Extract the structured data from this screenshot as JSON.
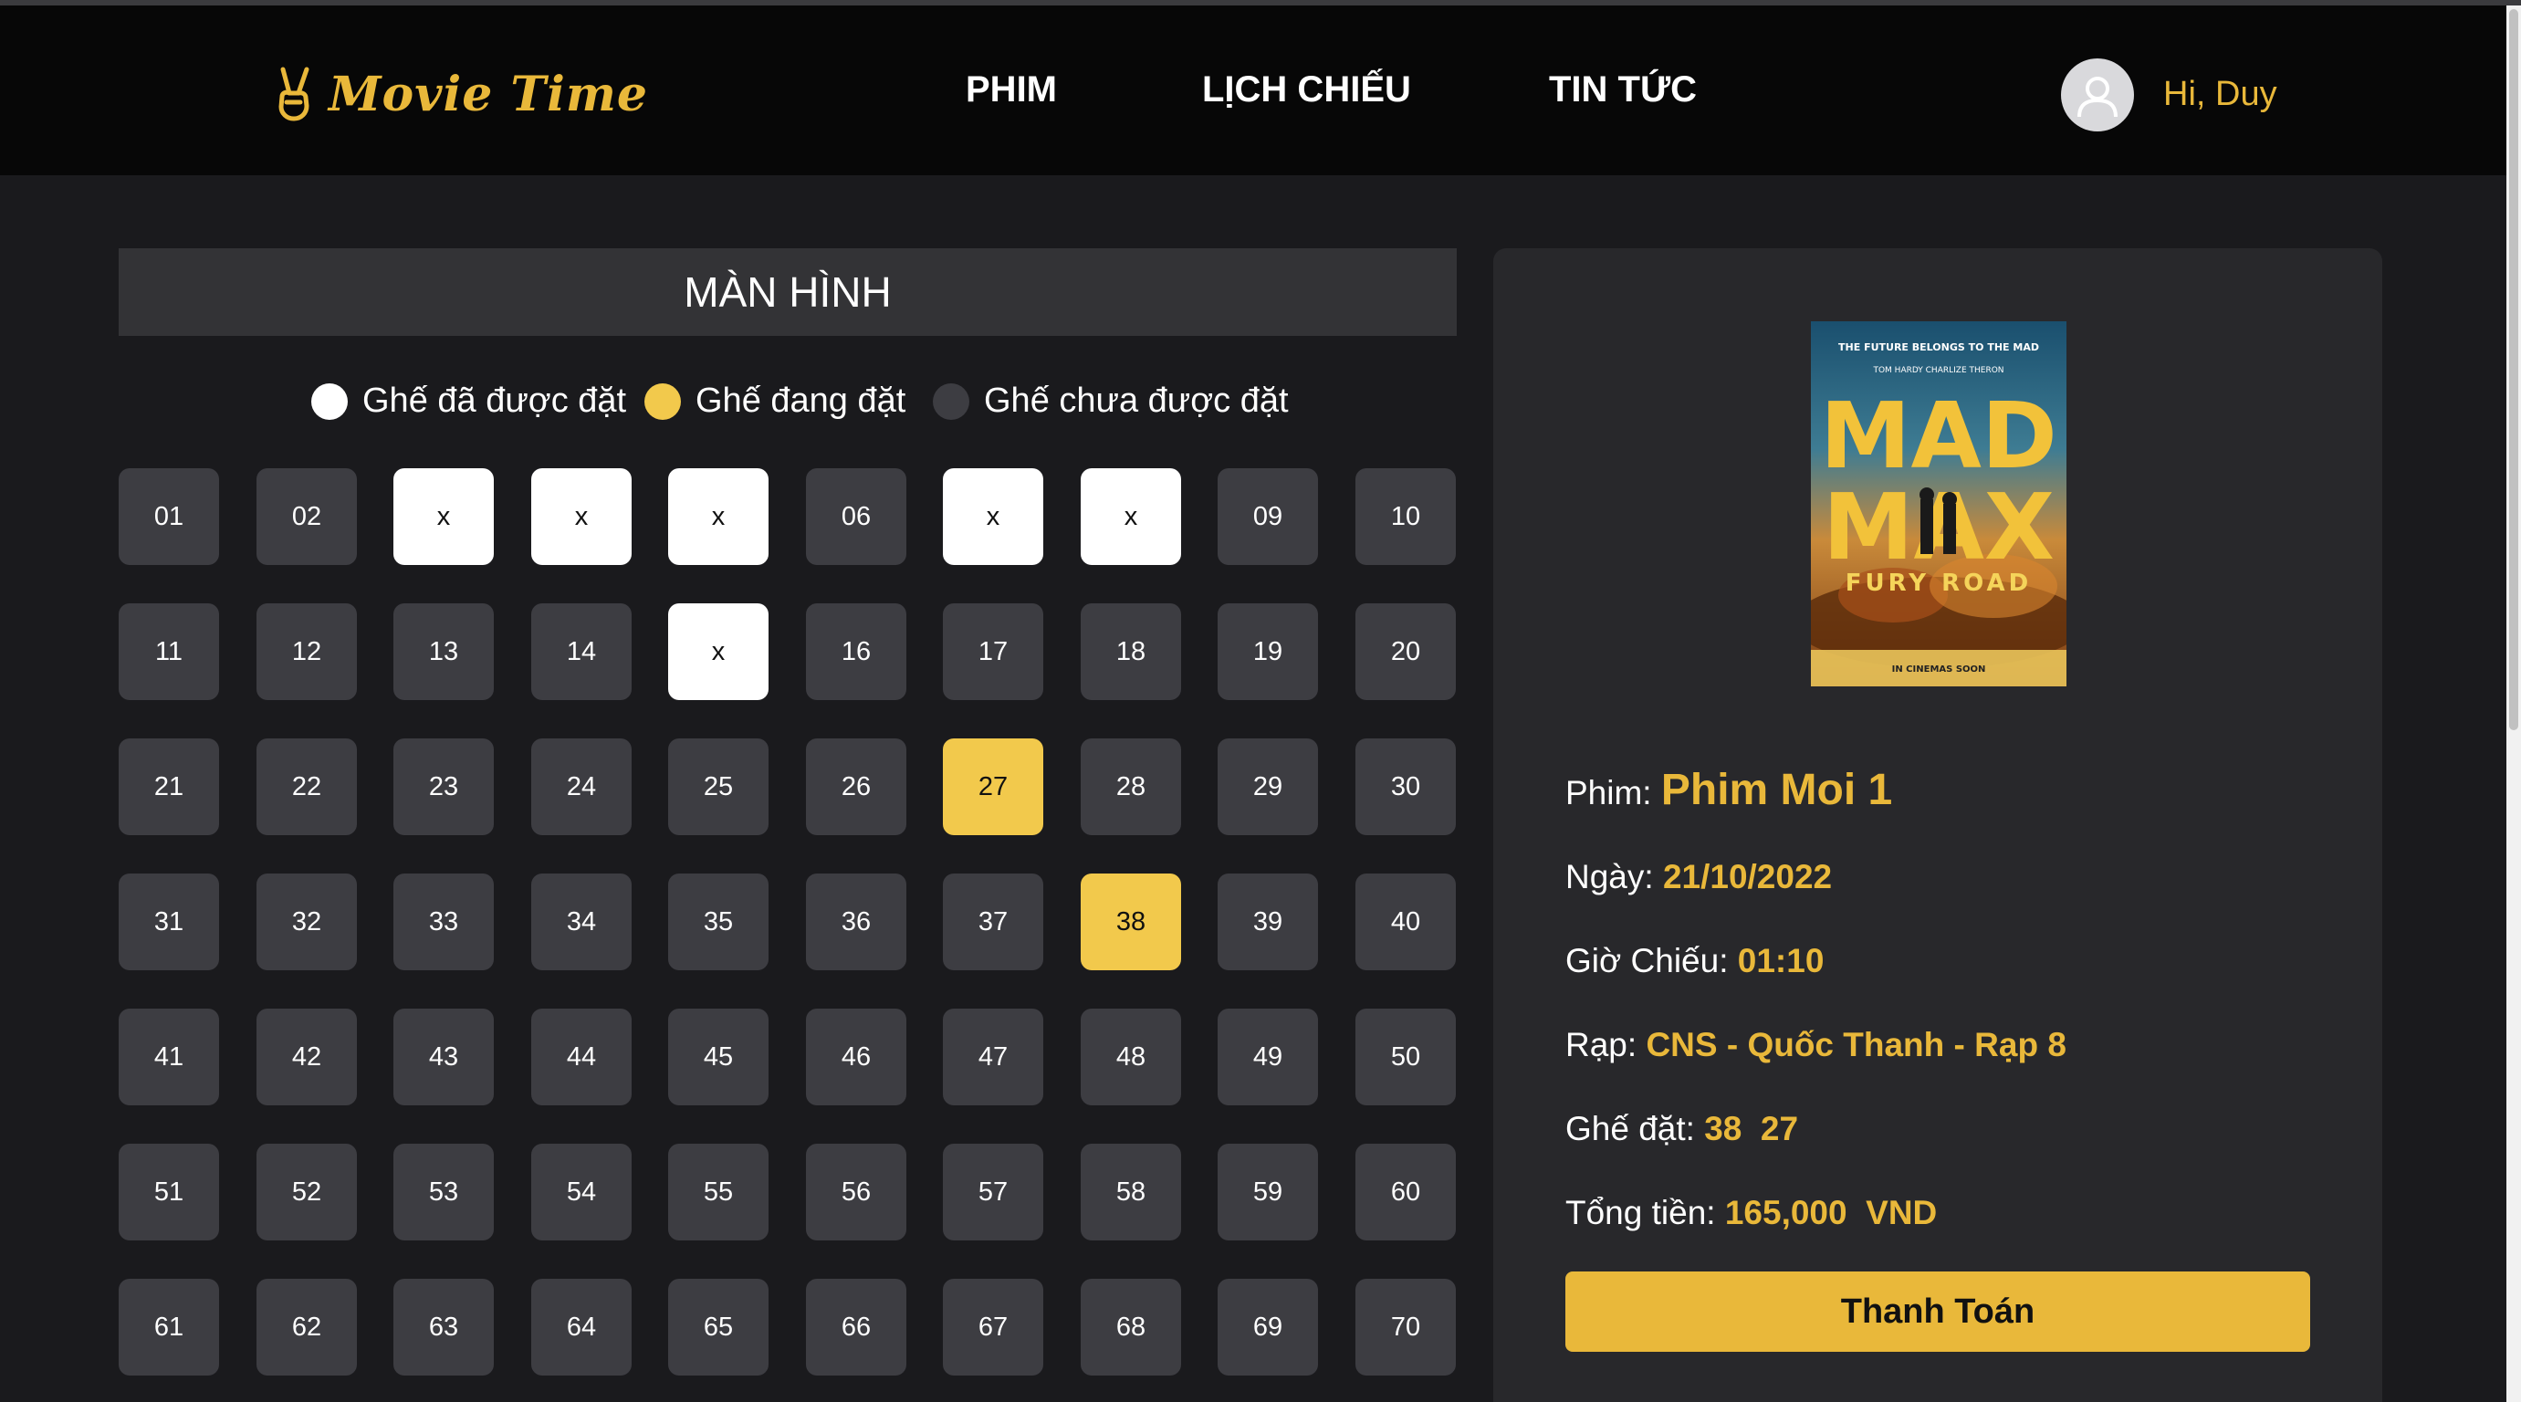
{
  "app": {
    "logo_text": "Movie Time",
    "nav": [
      "PHIM",
      "LỊCH CHIẾU",
      "TIN TỨC"
    ],
    "greeting": "Hi, Duy"
  },
  "screen_label": "MÀN HÌNH",
  "legend": {
    "booked": "Ghế đã được đặt",
    "selecting": "Ghế đang đặt",
    "available": "Ghế chưa được đặt"
  },
  "colors": {
    "accent": "#e9b83a",
    "seat_available": "#3d3d42",
    "seat_booked": "#ffffff",
    "seat_selecting": "#f2c94c",
    "header_bg": "#070707",
    "page_bg": "#1a1a1d",
    "panel_bg": "#28282b"
  },
  "seats": [
    {
      "label": "01",
      "status": "available"
    },
    {
      "label": "02",
      "status": "available"
    },
    {
      "label": "x",
      "status": "booked"
    },
    {
      "label": "x",
      "status": "booked"
    },
    {
      "label": "x",
      "status": "booked"
    },
    {
      "label": "06",
      "status": "available"
    },
    {
      "label": "x",
      "status": "booked"
    },
    {
      "label": "x",
      "status": "booked"
    },
    {
      "label": "09",
      "status": "available"
    },
    {
      "label": "10",
      "status": "available"
    },
    {
      "label": "11",
      "status": "available"
    },
    {
      "label": "12",
      "status": "available"
    },
    {
      "label": "13",
      "status": "available"
    },
    {
      "label": "14",
      "status": "available"
    },
    {
      "label": "x",
      "status": "booked"
    },
    {
      "label": "16",
      "status": "available"
    },
    {
      "label": "17",
      "status": "available"
    },
    {
      "label": "18",
      "status": "available"
    },
    {
      "label": "19",
      "status": "available"
    },
    {
      "label": "20",
      "status": "available"
    },
    {
      "label": "21",
      "status": "available"
    },
    {
      "label": "22",
      "status": "available"
    },
    {
      "label": "23",
      "status": "available"
    },
    {
      "label": "24",
      "status": "available"
    },
    {
      "label": "25",
      "status": "available"
    },
    {
      "label": "26",
      "status": "available"
    },
    {
      "label": "27",
      "status": "selecting"
    },
    {
      "label": "28",
      "status": "available"
    },
    {
      "label": "29",
      "status": "available"
    },
    {
      "label": "30",
      "status": "available"
    },
    {
      "label": "31",
      "status": "available"
    },
    {
      "label": "32",
      "status": "available"
    },
    {
      "label": "33",
      "status": "available"
    },
    {
      "label": "34",
      "status": "available"
    },
    {
      "label": "35",
      "status": "available"
    },
    {
      "label": "36",
      "status": "available"
    },
    {
      "label": "37",
      "status": "available"
    },
    {
      "label": "38",
      "status": "selecting"
    },
    {
      "label": "39",
      "status": "available"
    },
    {
      "label": "40",
      "status": "available"
    },
    {
      "label": "41",
      "status": "available"
    },
    {
      "label": "42",
      "status": "available"
    },
    {
      "label": "43",
      "status": "available"
    },
    {
      "label": "44",
      "status": "available"
    },
    {
      "label": "45",
      "status": "available"
    },
    {
      "label": "46",
      "status": "available"
    },
    {
      "label": "47",
      "status": "available"
    },
    {
      "label": "48",
      "status": "available"
    },
    {
      "label": "49",
      "status": "available"
    },
    {
      "label": "50",
      "status": "available"
    },
    {
      "label": "51",
      "status": "available"
    },
    {
      "label": "52",
      "status": "available"
    },
    {
      "label": "53",
      "status": "available"
    },
    {
      "label": "54",
      "status": "available"
    },
    {
      "label": "55",
      "status": "available"
    },
    {
      "label": "56",
      "status": "available"
    },
    {
      "label": "57",
      "status": "available"
    },
    {
      "label": "58",
      "status": "available"
    },
    {
      "label": "59",
      "status": "available"
    },
    {
      "label": "60",
      "status": "available"
    },
    {
      "label": "61",
      "status": "available"
    },
    {
      "label": "62",
      "status": "available"
    },
    {
      "label": "63",
      "status": "available"
    },
    {
      "label": "64",
      "status": "available"
    },
    {
      "label": "65",
      "status": "available"
    },
    {
      "label": "66",
      "status": "available"
    },
    {
      "label": "67",
      "status": "available"
    },
    {
      "label": "68",
      "status": "available"
    },
    {
      "label": "69",
      "status": "available"
    },
    {
      "label": "70",
      "status": "available"
    }
  ],
  "poster": {
    "tagline": "THE FUTURE BELONGS TO THE MAD",
    "actors": "TOM HARDY   CHARLIZE THERON",
    "title_line1": "MAD",
    "title_line2": "MAX",
    "subtitle": "FURY ROAD",
    "footer": "IN CINEMAS SOON"
  },
  "booking": {
    "movie_label": "Phim:",
    "movie_value": "Phim Moi 1",
    "date_label": "Ngày:",
    "date_value": "21/10/2022",
    "time_label": "Giờ Chiếu:",
    "time_value": "01:10",
    "cinema_label": "Rạp:",
    "cinema_value": "CNS - Quốc Thanh - Rạp 8",
    "seats_label": "Ghế đặt:",
    "seats_value": "38  27",
    "total_label": "Tổng tiền:",
    "total_value": "165,000  VND",
    "pay_button": "Thanh Toán"
  }
}
